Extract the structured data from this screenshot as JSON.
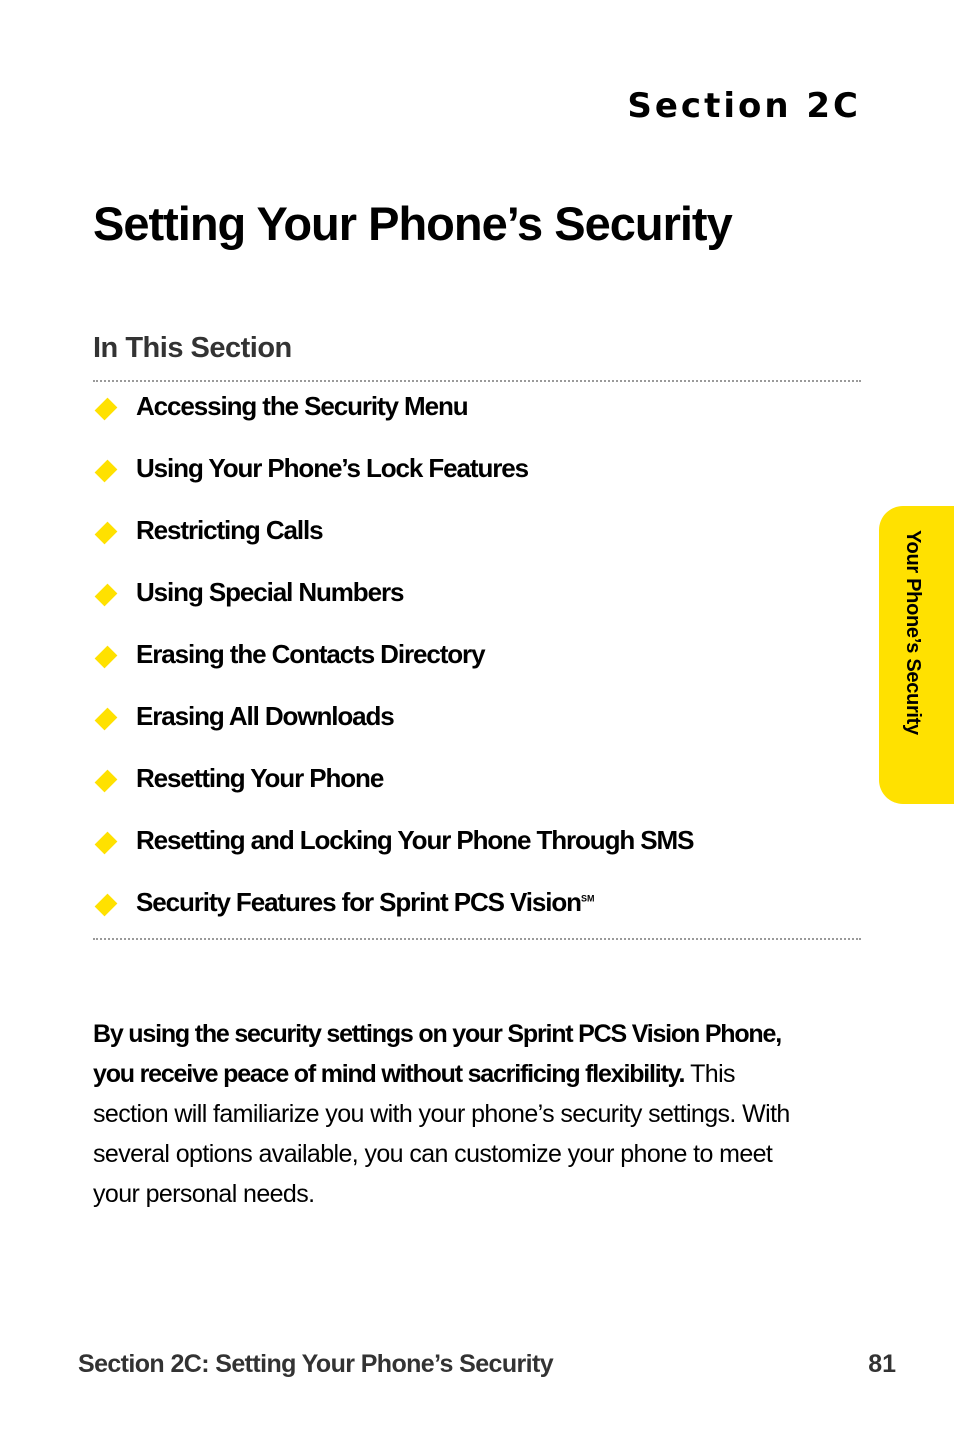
{
  "header": {
    "section_label": "Section 2C",
    "page_title": "Setting Your Phone’s Security"
  },
  "in_this_section": {
    "heading": "In This Section",
    "bullet_icon": "yellow-diamond",
    "items": [
      {
        "label": "Accessing the Security Menu"
      },
      {
        "label": "Using Your Phone’s Lock Features"
      },
      {
        "label": "Restricting Calls"
      },
      {
        "label": "Using Special Numbers"
      },
      {
        "label": "Erasing the Contacts Directory"
      },
      {
        "label": "Erasing All Downloads"
      },
      {
        "label": "Resetting Your Phone"
      },
      {
        "label": "Resetting and Locking Your Phone Through SMS"
      },
      {
        "label": "Security Features for Sprint PCS Vision",
        "superscript": "SM"
      }
    ]
  },
  "intro": {
    "bold_text": "By using the security settings on your Sprint PCS Vision Phone, you receive peace of mind without sacrificing flexibility.",
    "body_text": " This section will familiarize you with your phone’s security settings. With several options available, you can customize your phone to meet your personal needs."
  },
  "side_tab": {
    "label": "Your Phone’s Security"
  },
  "footer": {
    "title": "Section 2C: Setting Your Phone’s Security",
    "page_number": "81"
  },
  "colors": {
    "accent_yellow": "#ffe100",
    "text": "#000000",
    "footer_text": "#333333",
    "divider": "#9a9a9a"
  }
}
